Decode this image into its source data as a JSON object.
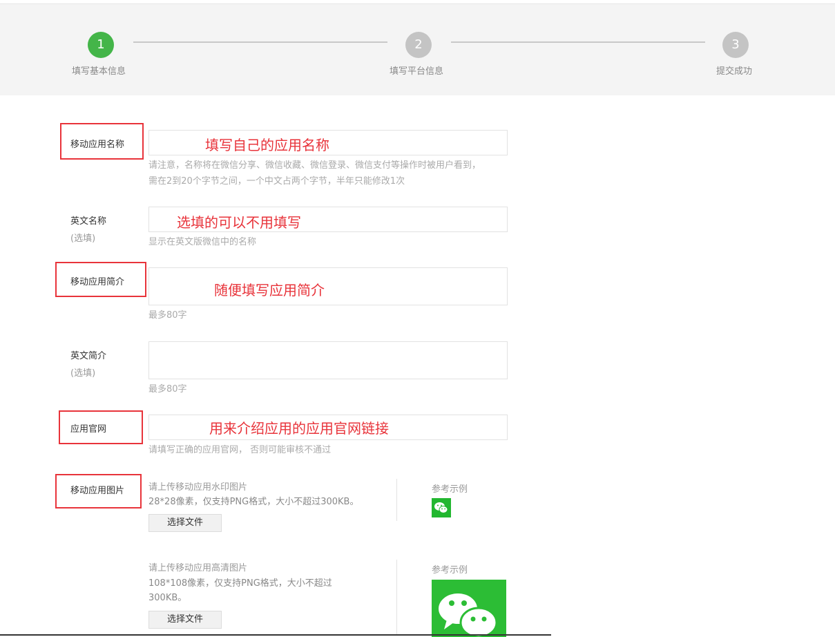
{
  "steps": [
    {
      "number": "1",
      "label": "填写基本信息",
      "state": "active"
    },
    {
      "number": "2",
      "label": "填写平台信息",
      "state": "pending"
    },
    {
      "number": "3",
      "label": "提交成功",
      "state": "pending"
    }
  ],
  "colors": {
    "active": "#44b549",
    "pending": "#c4c4c4",
    "annotation": "#e8333a",
    "wechat_green": "#2cbd35"
  },
  "form": {
    "app_name": {
      "label": "移动应用名称",
      "annotation": "填写自己的应用名称",
      "hint_line1": "请注意，名称将在微信分享、微信收藏、微信登录、微信支付等操作时被用户看到，",
      "hint_line2": "需在2到20个字节之间，一个中文占两个字节，半年只能修改1次"
    },
    "english_name": {
      "label": "英文名称",
      "optional": "(选填)",
      "annotation": "选填的可以不用填写",
      "hint": "显示在英文版微信中的名称"
    },
    "app_intro": {
      "label": "移动应用简介",
      "annotation": "随便填写应用简介",
      "hint": "最多80字"
    },
    "english_intro": {
      "label": "英文简介",
      "optional": "(选填)",
      "hint": "最多80字"
    },
    "website": {
      "label": "应用官网",
      "annotation": "用来介绍应用的应用官网链接",
      "hint": "请填写正确的应用官网， 否则可能审核不通过"
    },
    "app_image": {
      "label": "移动应用图片",
      "watermark": {
        "title": "请上传移动应用水印图片",
        "spec": "28*28像素，仅支持PNG格式，大小不超过300KB。",
        "button": "选择文件",
        "ref_label": "参考示例",
        "ref_icon": "wechat-icon"
      },
      "hd": {
        "title": "请上传移动应用高清图片",
        "spec_line1": "108*108像素，仅支持PNG格式，大小不超过",
        "spec_line2": "300KB。",
        "button": "选择文件",
        "ref_label": "参考示例",
        "ref_icon": "wechat-icon"
      }
    }
  }
}
